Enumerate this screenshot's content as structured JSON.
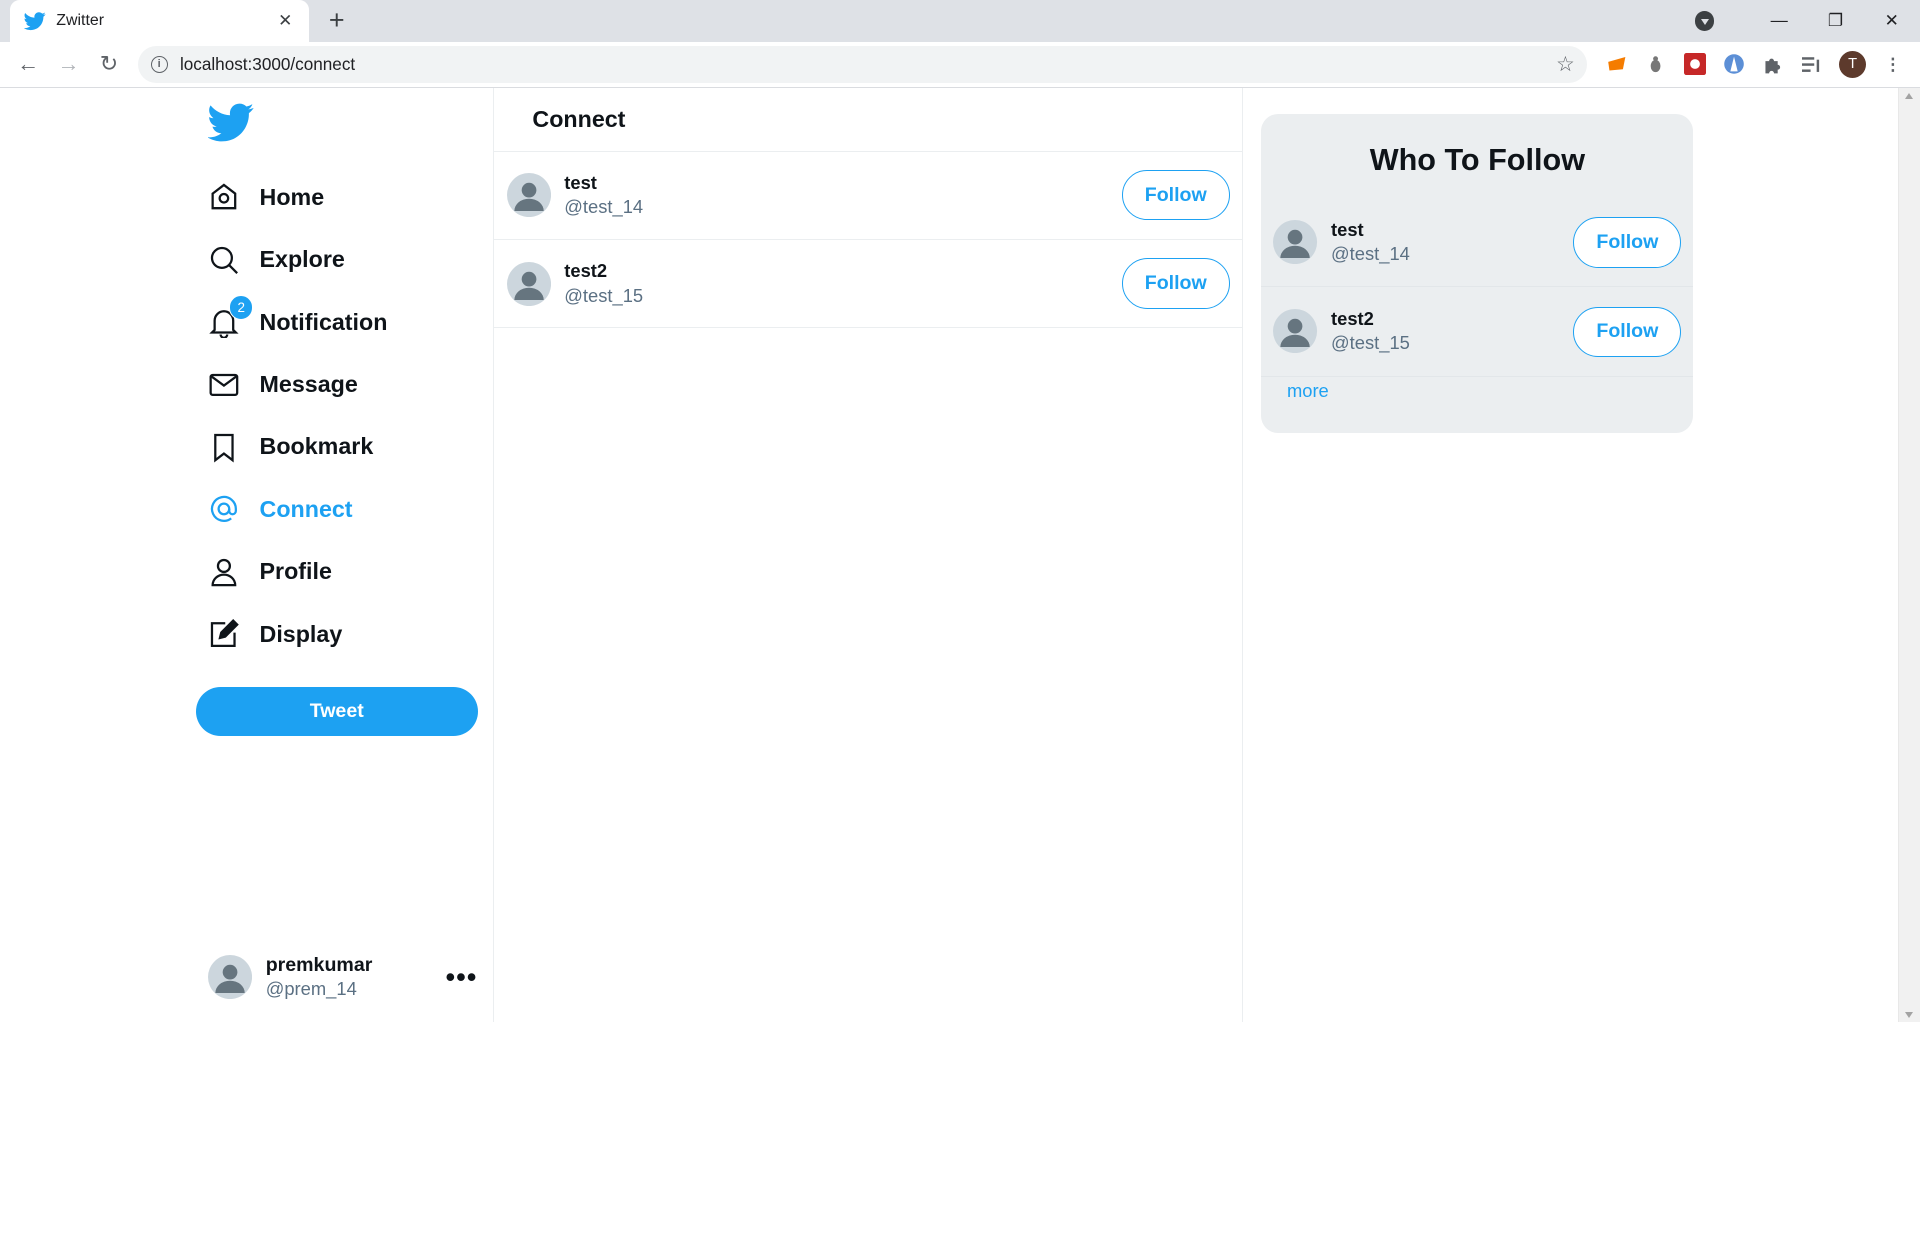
{
  "browser": {
    "tab_title": "Zwitter",
    "tab_close": "✕",
    "new_tab": "+",
    "url": "localhost:3000/connect",
    "window_controls": [
      "—",
      "❐",
      "✕"
    ],
    "profile_initial": "T"
  },
  "sidebar": {
    "items": [
      {
        "label": "Home",
        "icon": "home-icon"
      },
      {
        "label": "Explore",
        "icon": "search-icon"
      },
      {
        "label": "Notification",
        "icon": "bell-icon",
        "badge": "2"
      },
      {
        "label": "Message",
        "icon": "mail-icon"
      },
      {
        "label": "Bookmark",
        "icon": "bookmark-icon"
      },
      {
        "label": "Connect",
        "icon": "at-icon",
        "active": true
      },
      {
        "label": "Profile",
        "icon": "user-icon"
      },
      {
        "label": "Display",
        "icon": "edit-icon"
      }
    ],
    "tweet_label": "Tweet",
    "me": {
      "name": "premkumar",
      "handle": "@prem_14",
      "more": "•••"
    }
  },
  "main": {
    "title": "Connect",
    "users": [
      {
        "name": "test",
        "handle": "@test_14",
        "button": "Follow"
      },
      {
        "name": "test2",
        "handle": "@test_15",
        "button": "Follow"
      }
    ]
  },
  "aside": {
    "title": "Who To Follow",
    "users": [
      {
        "name": "test",
        "handle": "@test_14",
        "button": "Follow"
      },
      {
        "name": "test2",
        "handle": "@test_15",
        "button": "Follow"
      }
    ],
    "more_label": "more"
  },
  "colors": {
    "accent": "#1da1f2",
    "text": "#0f1419",
    "muted": "#5b7083",
    "panel": "#ebeef0"
  }
}
